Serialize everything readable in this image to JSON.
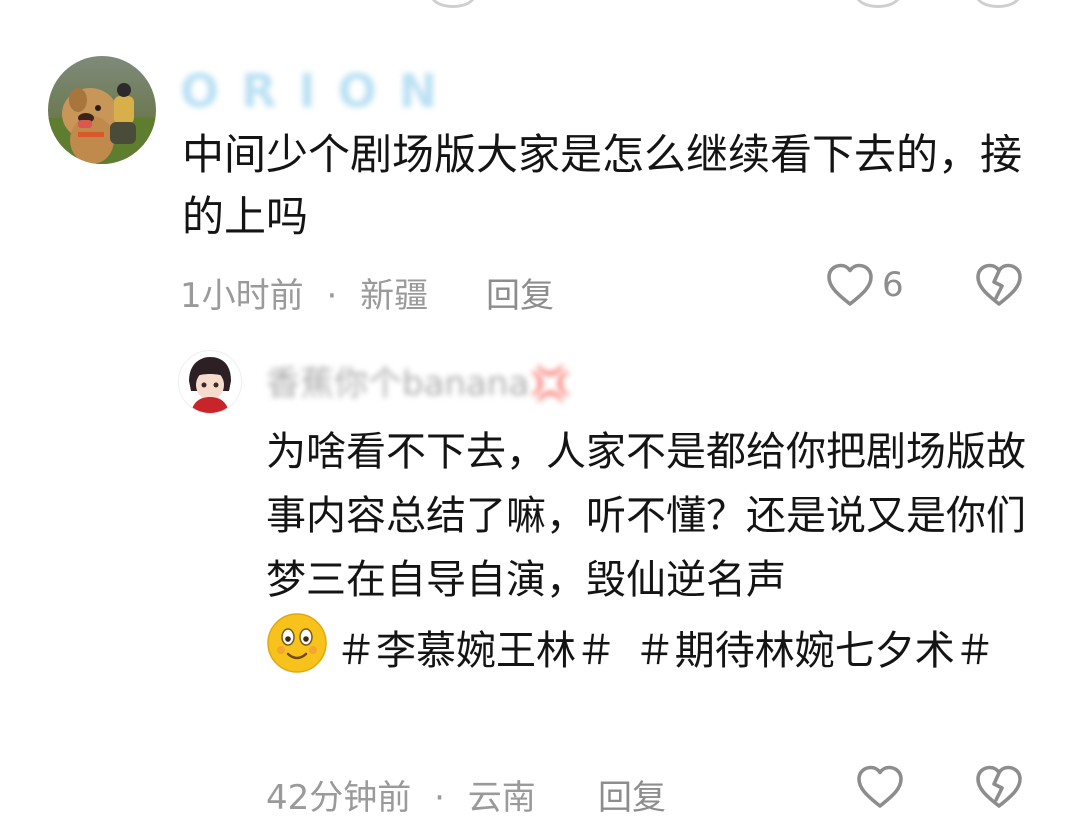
{
  "comments": [
    {
      "username": "ORION",
      "text": "中间少个剧场版大家是怎么继续看下去的，接的上吗",
      "time": "1小时前",
      "location": "新疆",
      "meta_separator": "·",
      "reply_label": "回复",
      "like_count": "6"
    }
  ],
  "reply": {
    "username": "香蕉你个banana💢",
    "text_part1": "为啥看不下去，人家不是都给你把剧场版故事内容总结了嘛，听不懂？还是说又是你们梦三在自导自演，毁仙逆名声",
    "hashtag1": "＃李慕婉王林＃",
    "hashtag2": "＃期待林婉七夕术＃",
    "time": "42分钟前",
    "location": "云南",
    "meta_separator": "·",
    "reply_label": "回复"
  },
  "colors": {
    "text": "#141414",
    "meta": "#9a9a9a",
    "icon": "#8d8d8d"
  }
}
